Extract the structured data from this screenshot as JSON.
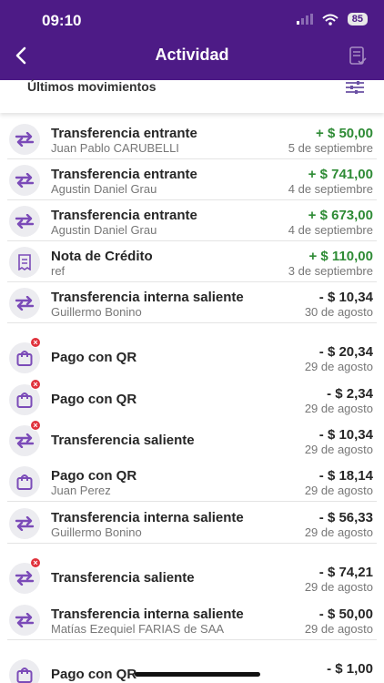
{
  "status": {
    "time": "09:10",
    "battery": "85"
  },
  "header": {
    "title": "Actividad"
  },
  "subheader": {
    "title": "Últimos movimientos"
  },
  "colors": {
    "header": "#4d1b86",
    "positive": "#2e8b35",
    "icon": "#7b4bb8",
    "badge": "#e0323c"
  },
  "transactions": [
    {
      "icon": "transfer-icon",
      "badge": false,
      "title": "Transferencia entrante",
      "subtitle": "Juan Pablo CARUBELLI",
      "amount": "+ $ 50,00",
      "positive": true,
      "date": "5 de septiembre"
    },
    {
      "icon": "transfer-icon",
      "badge": false,
      "title": "Transferencia entrante",
      "subtitle": "Agustin Daniel Grau",
      "amount": "+ $ 741,00",
      "positive": true,
      "date": "4 de septiembre"
    },
    {
      "icon": "transfer-icon",
      "badge": false,
      "title": "Transferencia entrante",
      "subtitle": "Agustin Daniel Grau",
      "amount": "+ $ 673,00",
      "positive": true,
      "date": "4 de septiembre"
    },
    {
      "icon": "receipt-icon",
      "badge": false,
      "title": "Nota de Crédito",
      "subtitle": "ref",
      "amount": "+ $ 110,00",
      "positive": true,
      "date": "3 de septiembre"
    },
    {
      "icon": "transfer-icon",
      "badge": false,
      "title": "Transferencia interna saliente",
      "subtitle": "Guillermo Bonino",
      "amount": "- $ 10,34",
      "positive": false,
      "date": "30 de agosto"
    },
    {
      "icon": "bag-icon",
      "badge": true,
      "title": "Pago con QR",
      "subtitle": "",
      "amount": "- $ 20,34",
      "positive": false,
      "date": "29 de agosto"
    },
    {
      "icon": "bag-icon",
      "badge": true,
      "title": "Pago con QR",
      "subtitle": "",
      "amount": "- $ 2,34",
      "positive": false,
      "date": "29 de agosto"
    },
    {
      "icon": "transfer-icon",
      "badge": true,
      "title": "Transferencia saliente",
      "subtitle": "",
      "amount": "- $ 10,34",
      "positive": false,
      "date": "29 de agosto"
    },
    {
      "icon": "bag-icon",
      "badge": false,
      "title": "Pago con QR",
      "subtitle": "Juan Perez",
      "amount": "- $ 18,14",
      "positive": false,
      "date": "29 de agosto"
    },
    {
      "icon": "transfer-icon",
      "badge": false,
      "title": "Transferencia interna saliente",
      "subtitle": "Guillermo Bonino",
      "amount": "- $ 56,33",
      "positive": false,
      "date": "29 de agosto"
    },
    {
      "icon": "transfer-icon",
      "badge": true,
      "title": "Transferencia saliente",
      "subtitle": "",
      "amount": "- $ 74,21",
      "positive": false,
      "date": "29 de agosto"
    },
    {
      "icon": "transfer-icon",
      "badge": false,
      "title": "Transferencia interna saliente",
      "subtitle": "Matías Ezequiel FARIAS de SAA",
      "amount": "- $ 50,00",
      "positive": false,
      "date": "29 de agosto"
    },
    {
      "icon": "bag-icon",
      "badge": false,
      "title": "Pago con QR",
      "subtitle": "",
      "amount": "- $ 1,00",
      "positive": false,
      "date": ""
    }
  ]
}
